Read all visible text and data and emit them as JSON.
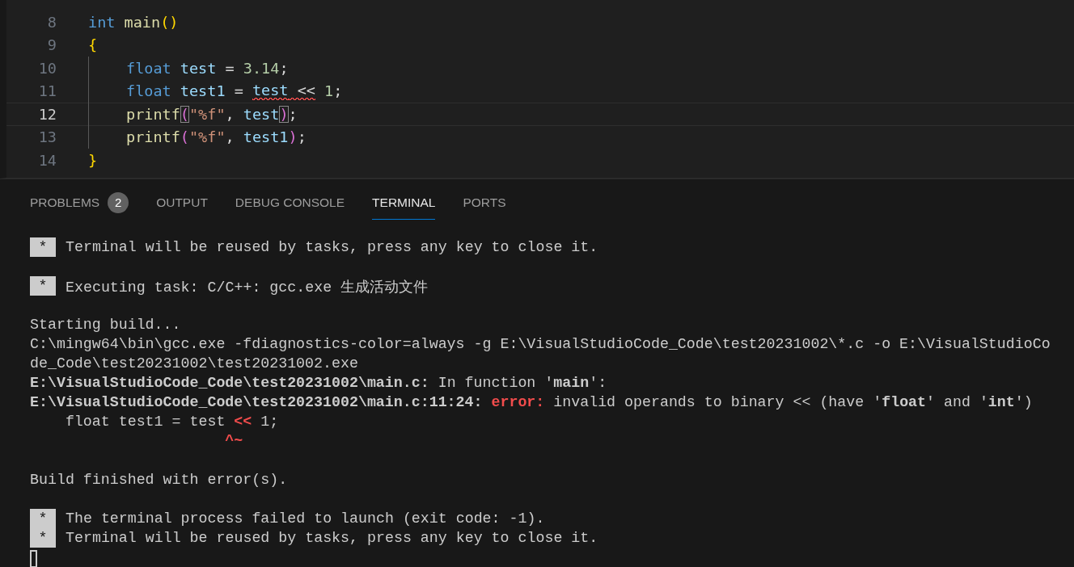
{
  "editor": {
    "lines": [
      {
        "number": "8",
        "current": false,
        "guide": false,
        "tokens": [
          {
            "t": "int ",
            "color": "#569cd6",
            "error": false,
            "boxed": false
          },
          {
            "t": "main",
            "color": "#dcdcaa",
            "error": false,
            "boxed": false
          },
          {
            "t": "()",
            "color": "#ffd700",
            "error": false,
            "boxed": false
          }
        ]
      },
      {
        "number": "9",
        "current": false,
        "guide": false,
        "tokens": [
          {
            "t": "{",
            "color": "#ffd700",
            "error": false,
            "boxed": false
          }
        ]
      },
      {
        "number": "10",
        "current": false,
        "guide": true,
        "tokens": [
          {
            "t": "float ",
            "color": "#569cd6",
            "error": false,
            "boxed": false
          },
          {
            "t": "test",
            "color": "#9cdcfe",
            "error": false,
            "boxed": false
          },
          {
            "t": " = ",
            "color": "#d4d4d4",
            "error": false,
            "boxed": false
          },
          {
            "t": "3.14",
            "color": "#b5cea8",
            "error": false,
            "boxed": false
          },
          {
            "t": ";",
            "color": "#d4d4d4",
            "error": false,
            "boxed": false
          }
        ]
      },
      {
        "number": "11",
        "current": false,
        "guide": true,
        "tokens": [
          {
            "t": "float ",
            "color": "#569cd6",
            "error": false,
            "boxed": false
          },
          {
            "t": "test1",
            "color": "#9cdcfe",
            "error": false,
            "boxed": false
          },
          {
            "t": " = ",
            "color": "#d4d4d4",
            "error": false,
            "boxed": false
          },
          {
            "t": "test",
            "color": "#9cdcfe",
            "error": true,
            "boxed": false
          },
          {
            "t": " <<",
            "color": "#d4d4d4",
            "error": true,
            "boxed": false
          },
          {
            "t": " 1",
            "color": "#b5cea8",
            "error": false,
            "boxed": false
          },
          {
            "t": ";",
            "color": "#d4d4d4",
            "error": false,
            "boxed": false
          }
        ]
      },
      {
        "number": "12",
        "current": true,
        "guide": true,
        "tokens": [
          {
            "t": "printf",
            "color": "#dcdcaa",
            "error": false,
            "boxed": false
          },
          {
            "t": "(",
            "color": "#da70d6",
            "error": false,
            "boxed": true
          },
          {
            "t": "\"%f\"",
            "color": "#ce9178",
            "error": false,
            "boxed": false
          },
          {
            "t": ", ",
            "color": "#d4d4d4",
            "error": false,
            "boxed": false
          },
          {
            "t": "test",
            "color": "#9cdcfe",
            "error": false,
            "boxed": false
          },
          {
            "t": ")",
            "color": "#da70d6",
            "error": false,
            "boxed": true
          },
          {
            "t": ";",
            "color": "#d4d4d4",
            "error": false,
            "boxed": false
          }
        ]
      },
      {
        "number": "13",
        "current": false,
        "guide": true,
        "tokens": [
          {
            "t": "printf",
            "color": "#dcdcaa",
            "error": false,
            "boxed": false
          },
          {
            "t": "(",
            "color": "#da70d6",
            "error": false,
            "boxed": false
          },
          {
            "t": "\"%f\"",
            "color": "#ce9178",
            "error": false,
            "boxed": false
          },
          {
            "t": ", ",
            "color": "#d4d4d4",
            "error": false,
            "boxed": false
          },
          {
            "t": "test1",
            "color": "#9cdcfe",
            "error": false,
            "boxed": false
          },
          {
            "t": ")",
            "color": "#da70d6",
            "error": false,
            "boxed": false
          },
          {
            "t": ";",
            "color": "#d4d4d4",
            "error": false,
            "boxed": false
          }
        ]
      },
      {
        "number": "14",
        "current": false,
        "guide": false,
        "tokens": [
          {
            "t": "}",
            "color": "#ffd700",
            "error": false,
            "boxed": false
          }
        ]
      }
    ]
  },
  "panel": {
    "tabs": [
      {
        "label": "PROBLEMS",
        "badge": "2",
        "selected": false
      },
      {
        "label": "OUTPUT",
        "selected": false
      },
      {
        "label": "DEBUG CONSOLE",
        "selected": false
      },
      {
        "label": "TERMINAL",
        "selected": true
      },
      {
        "label": "PORTS",
        "selected": false
      }
    ],
    "terminal": [
      {
        "kind": "task",
        "marker": "*",
        "segments": [
          {
            "text": "Terminal will be reused by tasks, press any key to close it.",
            "error": false
          }
        ]
      },
      {
        "kind": "blank"
      },
      {
        "kind": "task",
        "marker": "*",
        "segments": [
          {
            "text": "Executing task: C/C++: gcc.exe 生成活动文件",
            "error": false
          }
        ]
      },
      {
        "kind": "blank"
      },
      {
        "kind": "line",
        "segments": [
          {
            "text": "Starting build...",
            "error": false
          }
        ]
      },
      {
        "kind": "line",
        "segments": [
          {
            "text": "C:\\mingw64\\bin\\gcc.exe -fdiagnostics-color=always -g E:\\VisualStudioCode_Code\\test20231002\\*.c -o E:\\VisualStudioCo",
            "error": false
          }
        ]
      },
      {
        "kind": "line",
        "segments": [
          {
            "text": "de_Code\\test20231002\\test20231002.exe",
            "error": false
          }
        ]
      },
      {
        "kind": "line",
        "segments": [
          {
            "text": "**E:\\VisualStudioCode_Code\\test20231002\\main.c:** In function '**main**':",
            "error": false
          }
        ]
      },
      {
        "kind": "line",
        "segments": [
          {
            "text": "**E:\\VisualStudioCode_Code\\test20231002\\main.c:11:24:** ",
            "error": false
          },
          {
            "text": "error:",
            "error": true
          },
          {
            "text": " invalid operands to binary << (have '**float**' and '**int**')",
            "error": false
          }
        ]
      },
      {
        "kind": "line",
        "segments": [
          {
            "text": "    float test1 = test ",
            "error": false
          },
          {
            "text": "<<",
            "error": true
          },
          {
            "text": " 1;",
            "error": false
          }
        ]
      },
      {
        "kind": "line",
        "segments": [
          {
            "text": "                      ^~",
            "error": true
          }
        ]
      },
      {
        "kind": "blank"
      },
      {
        "kind": "line",
        "segments": [
          {
            "text": "Build finished with error(s).",
            "error": false
          }
        ]
      },
      {
        "kind": "blank"
      },
      {
        "kind": "task",
        "marker": "*",
        "segments": [
          {
            "text": "The terminal process failed to launch (exit code: -1).",
            "error": false
          }
        ]
      },
      {
        "kind": "task",
        "marker": "*",
        "segments": [
          {
            "text": "Terminal will be reused by tasks, press any key to close it.",
            "error": false
          }
        ]
      },
      {
        "kind": "cursor"
      }
    ]
  }
}
